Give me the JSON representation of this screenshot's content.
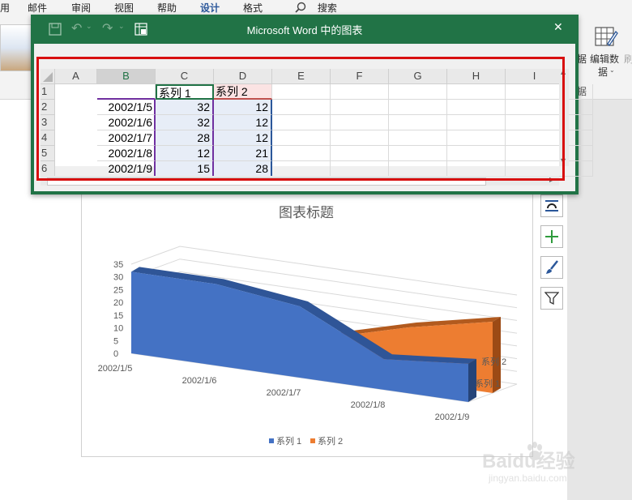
{
  "ribbon": {
    "tabs": [
      "用",
      "邮件",
      "审阅",
      "视图",
      "帮助",
      "设计",
      "格式"
    ],
    "active_tab": "设计",
    "search_label": "搜索",
    "edit_data_label": "编辑数据",
    "edit_data_line1": "编辑数",
    "edit_data_line2": "据",
    "side_text_1": "据",
    "side_text_2": "刷",
    "group_label_fragment": "据"
  },
  "excel_window": {
    "title": "Microsoft Word 中的图表",
    "close_symbol": "✕",
    "columns": [
      "A",
      "B",
      "C",
      "D",
      "E",
      "F",
      "G",
      "H",
      "I"
    ],
    "rows": [
      {
        "n": "1",
        "a": "",
        "b": "系列 1",
        "c": "系列 2"
      },
      {
        "n": "2",
        "a": "2002/1/5",
        "b": "32",
        "c": "12"
      },
      {
        "n": "3",
        "a": "2002/1/6",
        "b": "32",
        "c": "12"
      },
      {
        "n": "4",
        "a": "2002/1/7",
        "b": "28",
        "c": "12"
      },
      {
        "n": "5",
        "a": "2002/1/8",
        "b": "12",
        "c": "21"
      },
      {
        "n": "6",
        "a": "2002/1/9",
        "b": "15",
        "c": "28"
      }
    ]
  },
  "chart": {
    "title": "图表标题",
    "legend": [
      "系列 1",
      "系列 2"
    ],
    "depth_labels": [
      "系列 2",
      "系列 1"
    ]
  },
  "chart_data": {
    "type": "area",
    "title": "图表标题",
    "categories": [
      "2002/1/5",
      "2002/1/6",
      "2002/1/7",
      "2002/1/8",
      "2002/1/9"
    ],
    "y_ticks": [
      "0",
      "5",
      "10",
      "15",
      "20",
      "25",
      "30",
      "35"
    ],
    "ylim": [
      0,
      35
    ],
    "series": [
      {
        "name": "系列 1",
        "values": [
          32,
          32,
          28,
          12,
          15
        ]
      },
      {
        "name": "系列 2",
        "values": [
          12,
          12,
          12,
          21,
          28
        ]
      }
    ],
    "colors": {
      "系列 1": "#4472c4",
      "系列 2": "#ed7d31"
    },
    "legend_position": "bottom",
    "three_d": true
  },
  "watermark": {
    "brand": "Baidu经验",
    "url": "jingyan.baidu.com"
  },
  "colors": {
    "excel_green": "#217346",
    "highlight_red": "#d80f0f",
    "word_blue": "#2b579a"
  }
}
